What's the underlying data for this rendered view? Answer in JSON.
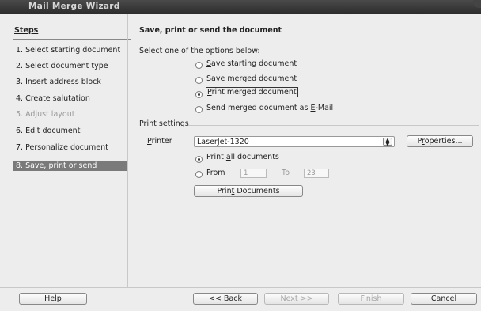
{
  "window": {
    "title": "Mail Merge Wizard"
  },
  "sidebar": {
    "title": "Steps",
    "steps": [
      {
        "label": "1. Select starting document"
      },
      {
        "label": "2. Select document type"
      },
      {
        "label": "3. Insert address block"
      },
      {
        "label": "4. Create salutation"
      },
      {
        "label": "5. Adjust layout"
      },
      {
        "label": "6. Edit document"
      },
      {
        "label": "7. Personalize document"
      },
      {
        "label": "8. Save, print or send"
      }
    ]
  },
  "main": {
    "heading": "Save, print or send the document",
    "select_label": "Select one of the options below:",
    "options": [
      {
        "pre": "",
        "acc": "S",
        "post": "ave starting document",
        "checked": false
      },
      {
        "pre": "Save ",
        "acc": "m",
        "post": "erged document",
        "checked": false
      },
      {
        "pre": "",
        "acc": "P",
        "post": "rint merged document",
        "checked": true
      },
      {
        "pre": "Send merged document as ",
        "acc": "E",
        "post": "-Mail",
        "checked": false
      }
    ],
    "print_settings": {
      "label": "Print settings",
      "printer_label": {
        "acc": "P",
        "post": "rinter"
      },
      "printer_value": "LaserJet-1320",
      "properties_button": {
        "pre": "P",
        "acc": "r",
        "post": "operties..."
      },
      "print_all": {
        "pre": "Print ",
        "acc": "a",
        "post": "ll documents",
        "checked": true
      },
      "from": {
        "acc": "F",
        "post": "rom",
        "value": "1"
      },
      "to": {
        "acc": "T",
        "post": "o",
        "value": "23"
      },
      "print_button": {
        "pre": "Prin",
        "acc": "t",
        "post": " Documents"
      }
    }
  },
  "footer": {
    "help": {
      "acc": "H",
      "post": "elp"
    },
    "back": {
      "pre": "<< Bac",
      "acc": "k",
      "post": ""
    },
    "next": {
      "acc": "N",
      "post": "ext >>"
    },
    "finish": {
      "acc": "F",
      "post": "inish"
    },
    "cancel": "Cancel"
  }
}
